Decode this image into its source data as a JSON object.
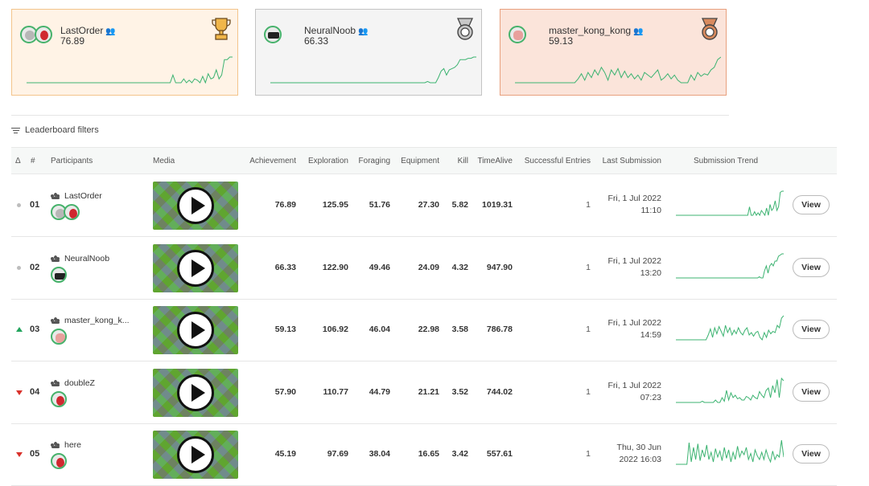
{
  "podium": [
    {
      "name": "LastOrder",
      "score": "76.89",
      "medal": "gold-trophy",
      "bg": "#fff3e6",
      "border": "#f3c48b",
      "trend": [
        0,
        0,
        0,
        0,
        0,
        0,
        0,
        0,
        0,
        0,
        0,
        0,
        0,
        0,
        0,
        0,
        0,
        0,
        0,
        0,
        0,
        0,
        0,
        0,
        0,
        0,
        0,
        0,
        0,
        0,
        0,
        0,
        0,
        0,
        0,
        0,
        0,
        0,
        0,
        0,
        0,
        0,
        0,
        0,
        0,
        0,
        0,
        0,
        0,
        0,
        0,
        0,
        0,
        0,
        0.3,
        0,
        0,
        0,
        0.15,
        0,
        0.1,
        0,
        0.15,
        0.1,
        0,
        0.25,
        0,
        0.35,
        0.15,
        0.2,
        0.5,
        0.15,
        0.3,
        0.9,
        0.9,
        1,
        1
      ]
    },
    {
      "name": "NeuralNoob",
      "score": "66.33",
      "medal": "silver-medal",
      "bg": "#f4f4f4",
      "border": "#c4c4c4",
      "trend": [
        0,
        0,
        0,
        0,
        0,
        0,
        0,
        0,
        0,
        0,
        0,
        0,
        0,
        0,
        0,
        0,
        0,
        0,
        0,
        0,
        0,
        0,
        0,
        0,
        0,
        0,
        0,
        0,
        0,
        0,
        0,
        0,
        0,
        0,
        0,
        0,
        0,
        0,
        0,
        0,
        0,
        0,
        0,
        0,
        0,
        0,
        0,
        0,
        0,
        0,
        0,
        0,
        0,
        0,
        0,
        0,
        0,
        0,
        0.05,
        0,
        0,
        0,
        0.2,
        0.45,
        0.55,
        0.3,
        0.5,
        0.55,
        0.6,
        0.7,
        0.9,
        0.9,
        0.9,
        0.95,
        0.95,
        1,
        1
      ]
    },
    {
      "name": "master_kong_kong",
      "score": "59.13",
      "medal": "bronze-medal",
      "bg": "#fbe4da",
      "border": "#e8a07e",
      "trend": [
        0,
        0,
        0,
        0,
        0,
        0,
        0,
        0,
        0,
        0,
        0,
        0,
        0,
        0,
        0,
        0,
        0,
        0,
        0,
        0.15,
        0.35,
        0.1,
        0.4,
        0.2,
        0.5,
        0.3,
        0.6,
        0.4,
        0.1,
        0.5,
        0.3,
        0.55,
        0.2,
        0.45,
        0.2,
        0.35,
        0.15,
        0.3,
        0.1,
        0.4,
        0.3,
        0.2,
        0.35,
        0.5,
        0.1,
        0.2,
        0.35,
        0.15,
        0.3,
        0.1,
        0,
        0,
        0,
        0.3,
        0.1,
        0.4,
        0.25,
        0.35,
        0.3,
        0.5,
        0.6,
        0.9,
        1
      ]
    }
  ],
  "filters_label": "Leaderboard filters",
  "columns": {
    "delta": "Δ",
    "rank": "#",
    "participants": "Participants",
    "media": "Media",
    "achievement": "Achievement",
    "exploration": "Exploration",
    "foraging": "Foraging",
    "equipment": "Equipment",
    "kill": "Kill",
    "timealive": "TimeAlive",
    "entries": "Successful Entries",
    "last": "Last Submission",
    "trend": "Submission Trend"
  },
  "rows": [
    {
      "delta": "same",
      "rank": "01",
      "name": "LastOrder",
      "avatars": [
        "gray",
        "red"
      ],
      "achievement": "76.89",
      "exploration": "125.95",
      "foraging": "51.76",
      "equipment": "27.30",
      "kill": "5.82",
      "timealive": "1019.31",
      "entries": "1",
      "date1": "Fri, 1 Jul 2022",
      "date2": "11:10",
      "view": "View",
      "trend": [
        0,
        0,
        0,
        0,
        0,
        0,
        0,
        0,
        0,
        0,
        0,
        0,
        0,
        0,
        0,
        0,
        0,
        0,
        0,
        0,
        0,
        0,
        0,
        0,
        0,
        0,
        0,
        0,
        0,
        0,
        0,
        0,
        0,
        0,
        0,
        0,
        0,
        0,
        0,
        0,
        0,
        0,
        0,
        0.35,
        0,
        0,
        0.15,
        0,
        0.1,
        0,
        0.2,
        0.1,
        0,
        0.3,
        0,
        0.45,
        0.2,
        0.3,
        0.6,
        0.2,
        0.35,
        0.95,
        1,
        1
      ]
    },
    {
      "delta": "same",
      "rank": "02",
      "name": "NeuralNoob",
      "avatars": [
        "noob"
      ],
      "achievement": "66.33",
      "exploration": "122.90",
      "foraging": "49.46",
      "equipment": "24.09",
      "kill": "4.32",
      "timealive": "947.90",
      "entries": "1",
      "date1": "Fri, 1 Jul 2022",
      "date2": "13:20",
      "view": "View",
      "trend": [
        0,
        0,
        0,
        0,
        0,
        0,
        0,
        0,
        0,
        0,
        0,
        0,
        0,
        0,
        0,
        0,
        0,
        0,
        0,
        0,
        0,
        0,
        0,
        0,
        0,
        0,
        0,
        0,
        0,
        0,
        0,
        0,
        0,
        0,
        0,
        0,
        0,
        0,
        0,
        0,
        0,
        0,
        0,
        0,
        0,
        0,
        0,
        0,
        0.05,
        0,
        0,
        0.3,
        0.5,
        0.2,
        0.5,
        0.6,
        0.5,
        0.7,
        0.7,
        0.9,
        0.95,
        1,
        1
      ]
    },
    {
      "delta": "up",
      "rank": "03",
      "name": "master_kong_k...",
      "avatars": [
        "kong"
      ],
      "achievement": "59.13",
      "exploration": "106.92",
      "foraging": "46.04",
      "equipment": "22.98",
      "kill": "3.58",
      "timealive": "786.78",
      "entries": "1",
      "date1": "Fri, 1 Jul 2022",
      "date2": "14:59",
      "view": "View",
      "trend": [
        0,
        0,
        0,
        0,
        0,
        0,
        0,
        0,
        0,
        0,
        0,
        0,
        0,
        0,
        0,
        0.2,
        0.45,
        0.1,
        0.5,
        0.25,
        0.55,
        0.35,
        0.15,
        0.6,
        0.3,
        0.5,
        0.2,
        0.4,
        0.25,
        0.5,
        0.3,
        0.2,
        0.4,
        0.5,
        0.2,
        0.3,
        0.15,
        0.3,
        0.35,
        0.1,
        0,
        0.3,
        0.1,
        0.4,
        0.25,
        0.35,
        0.3,
        0.6,
        0.5,
        0.9,
        1
      ]
    },
    {
      "delta": "down",
      "rank": "04",
      "name": "doubleZ",
      "avatars": [
        "red"
      ],
      "achievement": "57.90",
      "exploration": "110.77",
      "foraging": "44.79",
      "equipment": "21.21",
      "kill": "3.52",
      "timealive": "744.02",
      "entries": "1",
      "date1": "Fri, 1 Jul 2022",
      "date2": "07:23",
      "view": "View",
      "trend": [
        0,
        0,
        0,
        0,
        0,
        0,
        0,
        0,
        0,
        0,
        0,
        0,
        0.05,
        0,
        0,
        0,
        0,
        0,
        0.1,
        0,
        0,
        0.2,
        0.05,
        0.5,
        0.1,
        0.4,
        0.2,
        0.3,
        0.15,
        0.2,
        0.1,
        0.1,
        0.25,
        0.2,
        0.1,
        0.3,
        0.2,
        0.15,
        0.45,
        0.3,
        0.2,
        0.5,
        0.6,
        0.2,
        0.7,
        0.4,
        0.95,
        0.2,
        1,
        0.9
      ]
    },
    {
      "delta": "down",
      "rank": "05",
      "name": "here",
      "avatars": [
        "red"
      ],
      "achievement": "45.19",
      "exploration": "97.69",
      "foraging": "38.04",
      "equipment": "16.65",
      "kill": "3.42",
      "timealive": "557.61",
      "entries": "1",
      "date1": "Thu, 30 Jun",
      "date2": "2022 16:03",
      "view": "View",
      "trend": [
        0,
        0,
        0,
        0,
        0,
        0,
        0.9,
        0.1,
        0.7,
        0.2,
        0.85,
        0.15,
        0.6,
        0.3,
        0.8,
        0.2,
        0.5,
        0.1,
        0.65,
        0.3,
        0.55,
        0.15,
        0.7,
        0.25,
        0.6,
        0.1,
        0.5,
        0.2,
        0.75,
        0.3,
        0.55,
        0.4,
        0.7,
        0.2,
        0.45,
        0.1,
        0.6,
        0.35,
        0.2,
        0.5,
        0.2,
        0.6,
        0.3,
        0.1,
        0.55,
        0.2,
        0.4,
        0.3,
        1,
        0.3
      ]
    }
  ],
  "colors": {
    "trend": "#3cb371",
    "up": "#22a45d",
    "down": "#d9312b"
  }
}
